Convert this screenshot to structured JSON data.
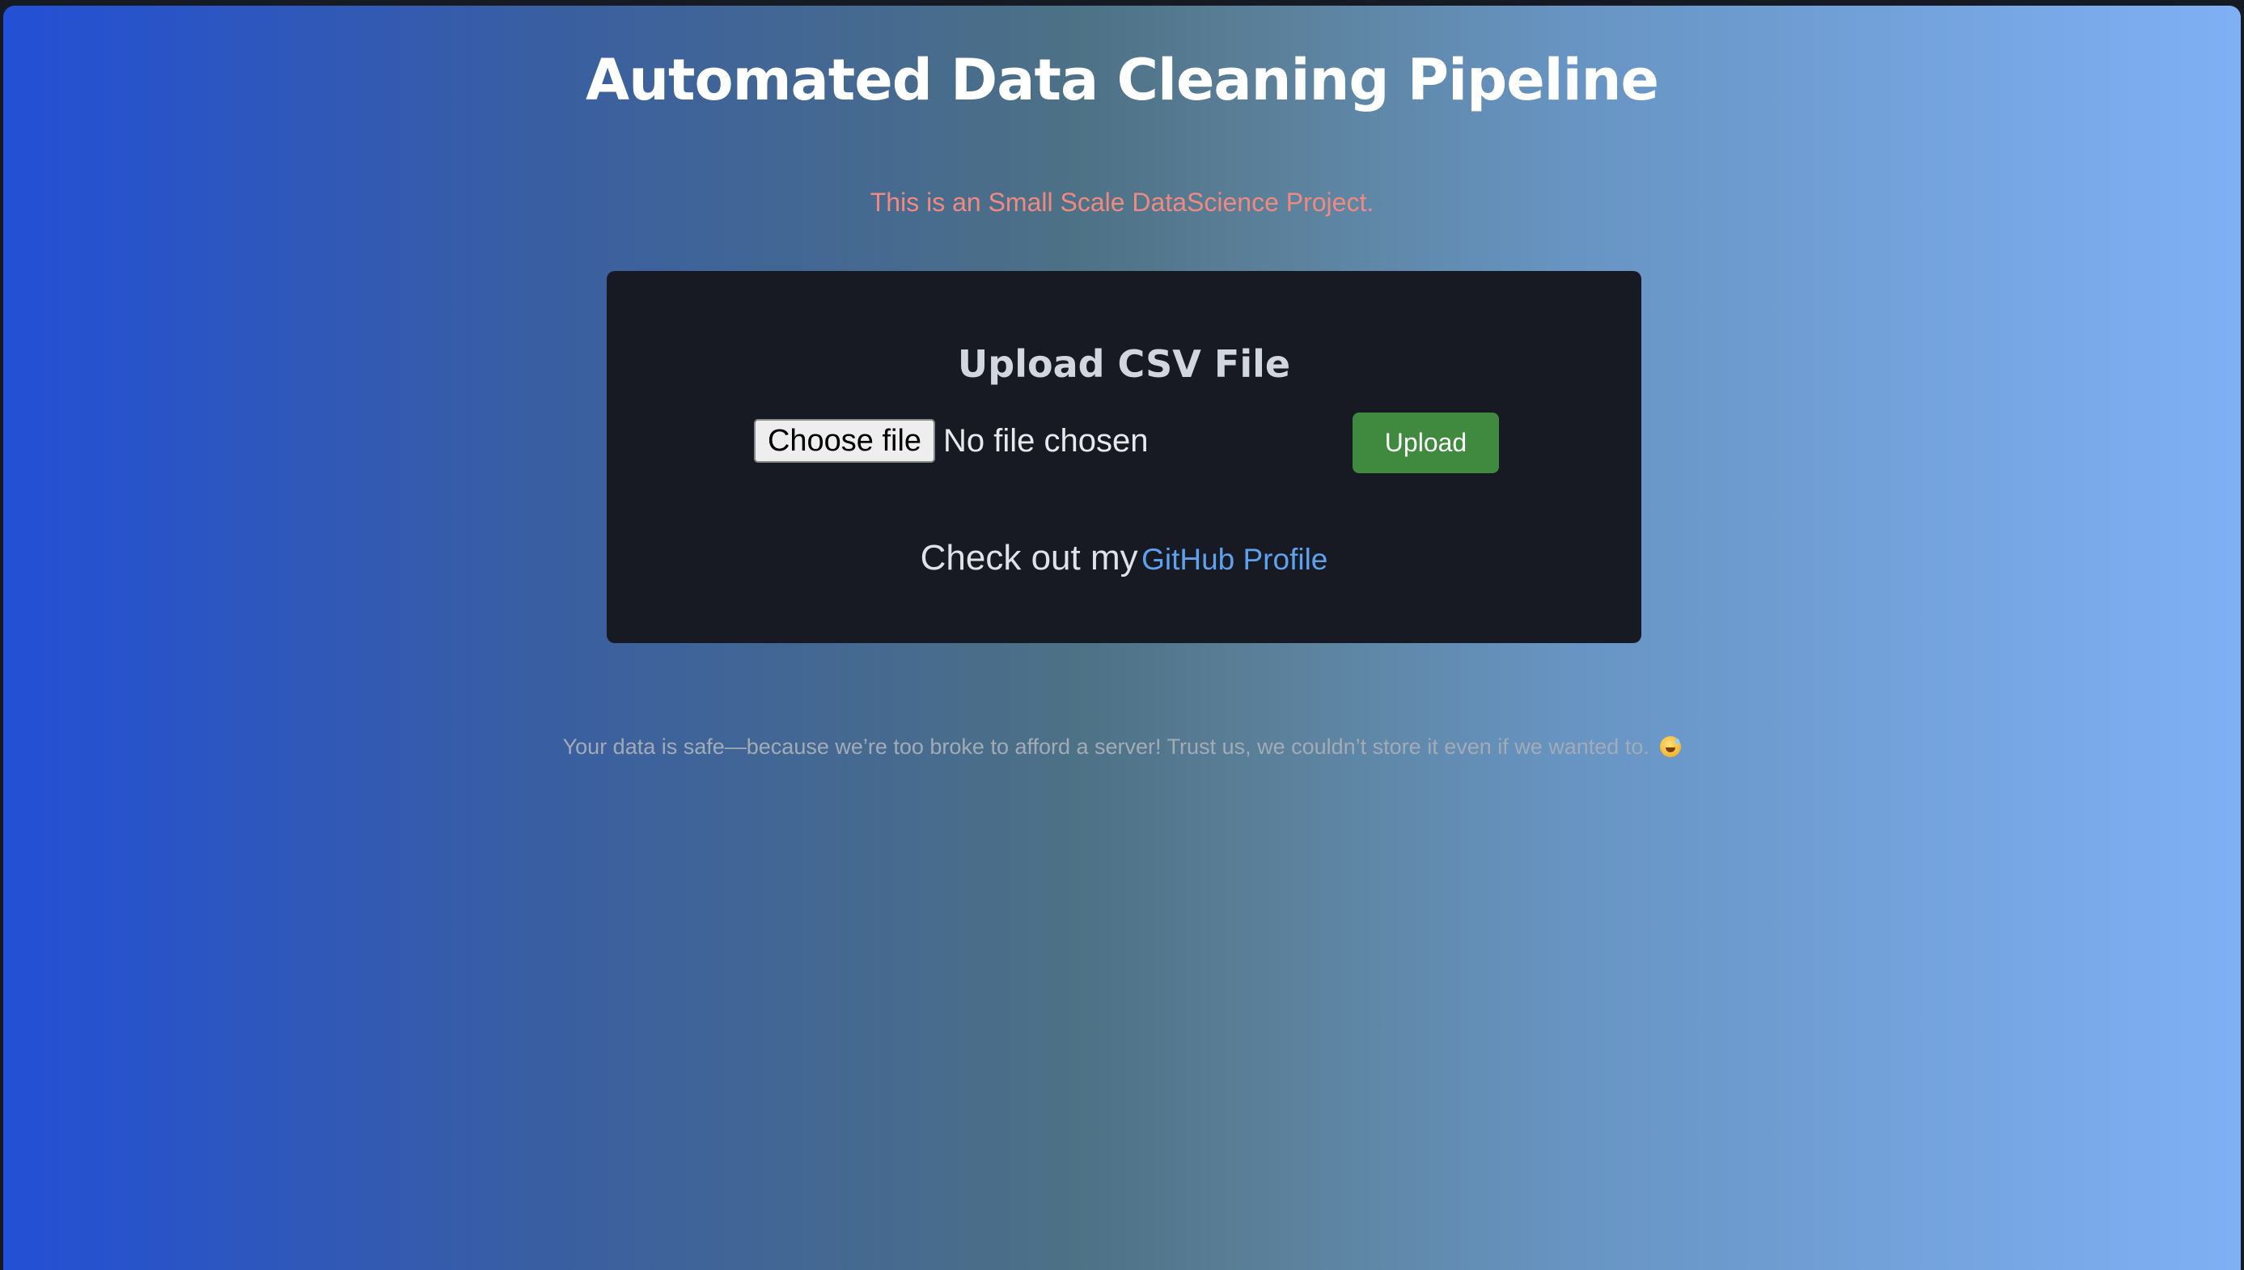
{
  "page": {
    "title": "Automated Data Cleaning Pipeline",
    "subtitle": "This is an Small Scale DataScience Project."
  },
  "upload_card": {
    "heading": "Upload CSV File",
    "choose_file_label": "Choose file",
    "no_file_text": "No file chosen",
    "upload_label": "Upload",
    "github_prefix": "Check out my",
    "github_link_text": "GitHub Profile"
  },
  "footer": {
    "text": "Your data is safe—because we’re too broke to afford a server! Trust us, we couldn’t store it even if we wanted to.",
    "emoji_icon": "grinning-sweat-emoji-icon"
  },
  "colors": {
    "gradient_start": "#2350d6",
    "gradient_mid": "#4d7185",
    "gradient_end": "#7fb0f5",
    "card_bg": "#171a22",
    "subtitle": "#f08a80",
    "upload_button": "#3f8a3e",
    "link": "#5ea1ef"
  }
}
